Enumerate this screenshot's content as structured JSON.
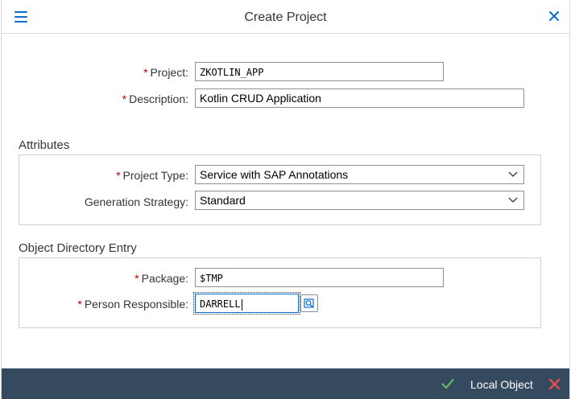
{
  "dialog": {
    "title": "Create Project"
  },
  "form": {
    "project": {
      "label": "Project:",
      "value": "ZKOTLIN_APP",
      "required": "*"
    },
    "description": {
      "label": "Description:",
      "value": "Kotlin CRUD Application",
      "required": "*"
    }
  },
  "attributes": {
    "section_title": "Attributes",
    "project_type": {
      "label": "Project Type:",
      "value": "Service with SAP Annotations",
      "required": "*"
    },
    "generation_strategy": {
      "label": "Generation Strategy:",
      "value": "Standard"
    }
  },
  "object_directory": {
    "section_title": "Object Directory Entry",
    "package": {
      "label": "Package:",
      "value": "$TMP",
      "required": "*"
    },
    "person_responsible": {
      "label": "Person Responsible:",
      "value": "DARRELL",
      "required": "*"
    }
  },
  "footer": {
    "local_object_label": "Local Object"
  },
  "icons": {
    "menu": "hamburger-menu-icon",
    "close": "close-icon",
    "dropdown": "chevron-down-icon",
    "value_help": "value-help-icon",
    "confirm": "checkmark-icon",
    "cancel": "cancel-x-icon"
  },
  "colors": {
    "accent": "#0a6ed1",
    "required": "#bb0000",
    "footer_bg": "#354a5f",
    "confirm_green": "#5fb85f",
    "cancel_red": "#e05050"
  }
}
